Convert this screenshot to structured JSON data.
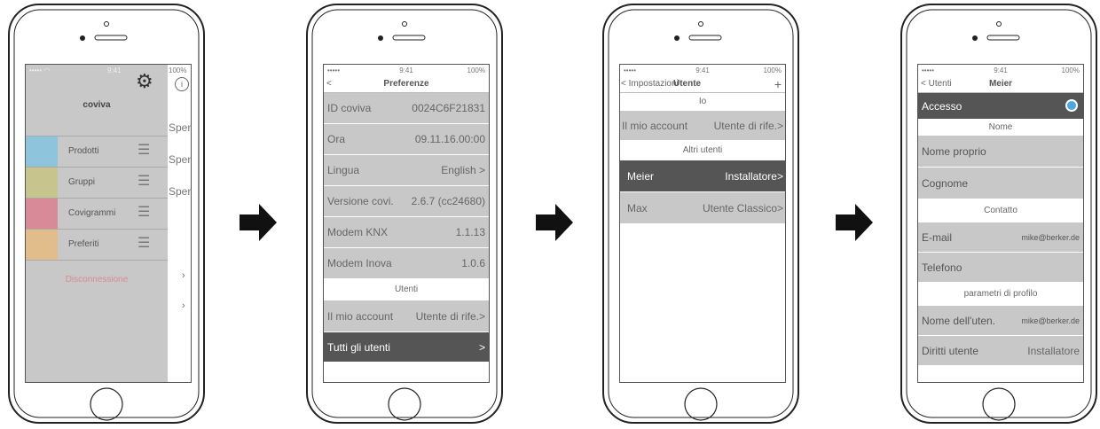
{
  "screen1": {
    "status": {
      "time": "9:41",
      "battery": "100%"
    },
    "app_name": "coviva",
    "menu": [
      {
        "label": "Prodotti",
        "color": "#8ec5dc"
      },
      {
        "label": "Gruppi",
        "color": "#c8c48e"
      },
      {
        "label": "Covigrammi",
        "color": "#d98a98"
      },
      {
        "label": "Preferiti",
        "color": "#e0bd8a"
      }
    ],
    "logout": "Disconnessione",
    "side_items": [
      "Spen.",
      "Spen.",
      "Spen."
    ],
    "colors": {
      "panel": "#c8c8c8",
      "logout": "#d98a98"
    }
  },
  "screen2": {
    "status": {
      "carrier": "•••••",
      "time": "9:41",
      "battery": "100%"
    },
    "nav": {
      "back": "<",
      "title": "Preferenze"
    },
    "rows": [
      {
        "label": "ID coviva",
        "value": "0024C6F21831"
      },
      {
        "label": "Ora",
        "value": "09.11.16.00:00"
      },
      {
        "label": "Lingua",
        "value": "English >"
      },
      {
        "label": "Versione covi.",
        "value": "2.6.7 (cc24680)"
      },
      {
        "label": "Modem KNX",
        "value": "1.1.13"
      },
      {
        "label": "Modem Inova",
        "value": "1.0.6"
      }
    ],
    "section": "Utenti",
    "account": {
      "label": "Il mio account",
      "value": "Utente di rife.>"
    },
    "all_users": {
      "label": "Tutti gli utenti",
      "value": ">"
    }
  },
  "screen3": {
    "status": {
      "carrier": "•••••",
      "time": "9:41",
      "battery": "100%"
    },
    "nav": {
      "back": "< Impostazioni",
      "title": "Utente",
      "add": "+"
    },
    "section_me": "Io",
    "account": {
      "label": "Il mio account",
      "value": "Utente di rife.>"
    },
    "section_others": "Altri utenti",
    "users": [
      {
        "label": "Meier",
        "value": "Installatore>",
        "selected": true
      },
      {
        "label": "Max",
        "value": "Utente Classico>",
        "selected": false
      }
    ]
  },
  "screen4": {
    "status": {
      "carrier": "•••••",
      "time": "9:41",
      "battery": "100%"
    },
    "nav": {
      "back": "< Utenti",
      "title": "Meier"
    },
    "access": {
      "label": "Accesso",
      "toggle_color": "#4aa8e0"
    },
    "section_name": "Nome",
    "first_name": "Nome proprio",
    "last_name": "Cognome",
    "section_contact": "Contatto",
    "email": {
      "label": "E-mail",
      "value": "mike@berker.de"
    },
    "phone": "Telefono",
    "section_profile": "parametri di profilo",
    "username": {
      "label": "Nome dell'uten.",
      "value": "mike@berker.de"
    },
    "rights": {
      "label": "Diritti utente",
      "value": "Installatore"
    }
  }
}
